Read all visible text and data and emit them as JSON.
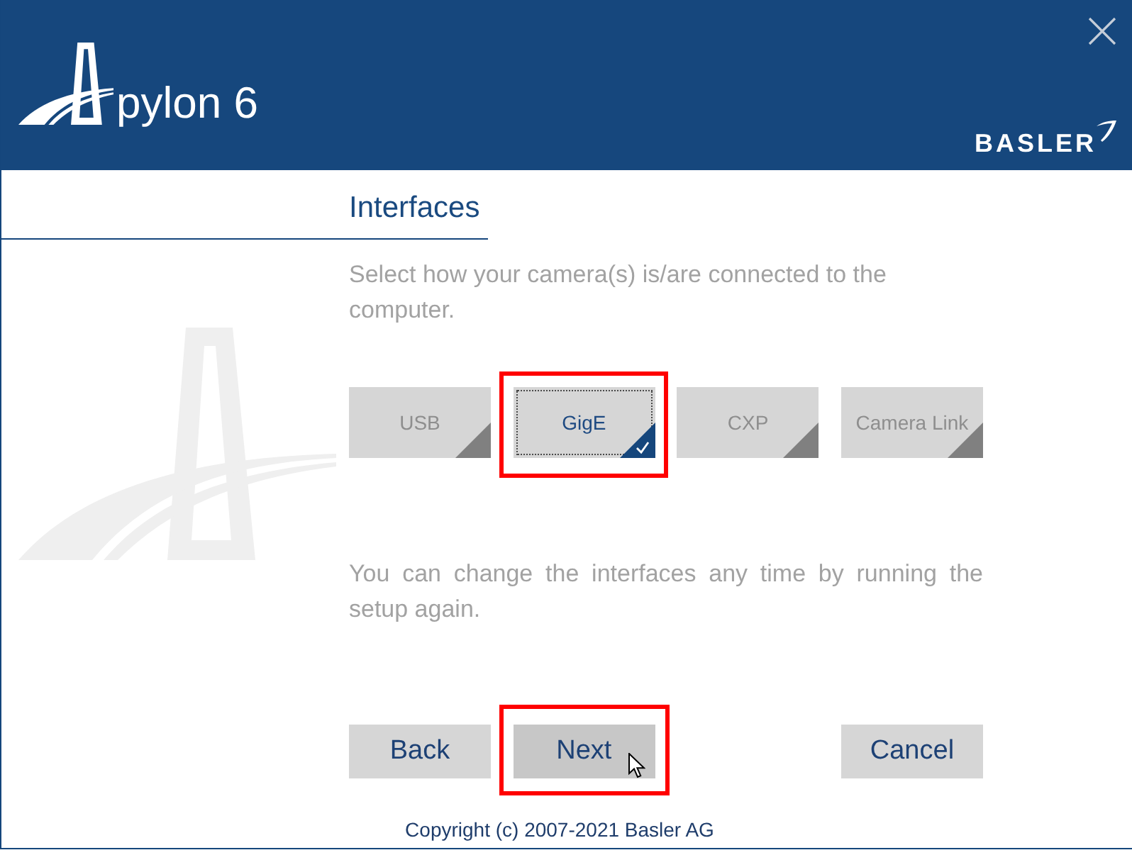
{
  "header": {
    "product_name": "pylon 6",
    "brand": "BASLER"
  },
  "page": {
    "title": "Interfaces",
    "description": "Select how your camera(s) is/are connected to the computer."
  },
  "interfaces": [
    {
      "label": "USB",
      "selected": false,
      "focused": false,
      "highlighted": false
    },
    {
      "label": "GigE",
      "selected": true,
      "focused": true,
      "highlighted": true
    },
    {
      "label": "CXP",
      "selected": false,
      "focused": false,
      "highlighted": false
    },
    {
      "label": "Camera Link",
      "selected": false,
      "focused": false,
      "highlighted": false
    }
  ],
  "note": "You can change the interfaces any time by running the setup again.",
  "buttons": [
    {
      "label": "Back",
      "hovered": false,
      "highlighted": false
    },
    {
      "label": "Next",
      "hovered": true,
      "highlighted": true
    },
    {
      "label": "Cancel",
      "hovered": false,
      "highlighted": false
    }
  ],
  "copyright": "Copyright (c) 2007-2021 Basler AG"
}
